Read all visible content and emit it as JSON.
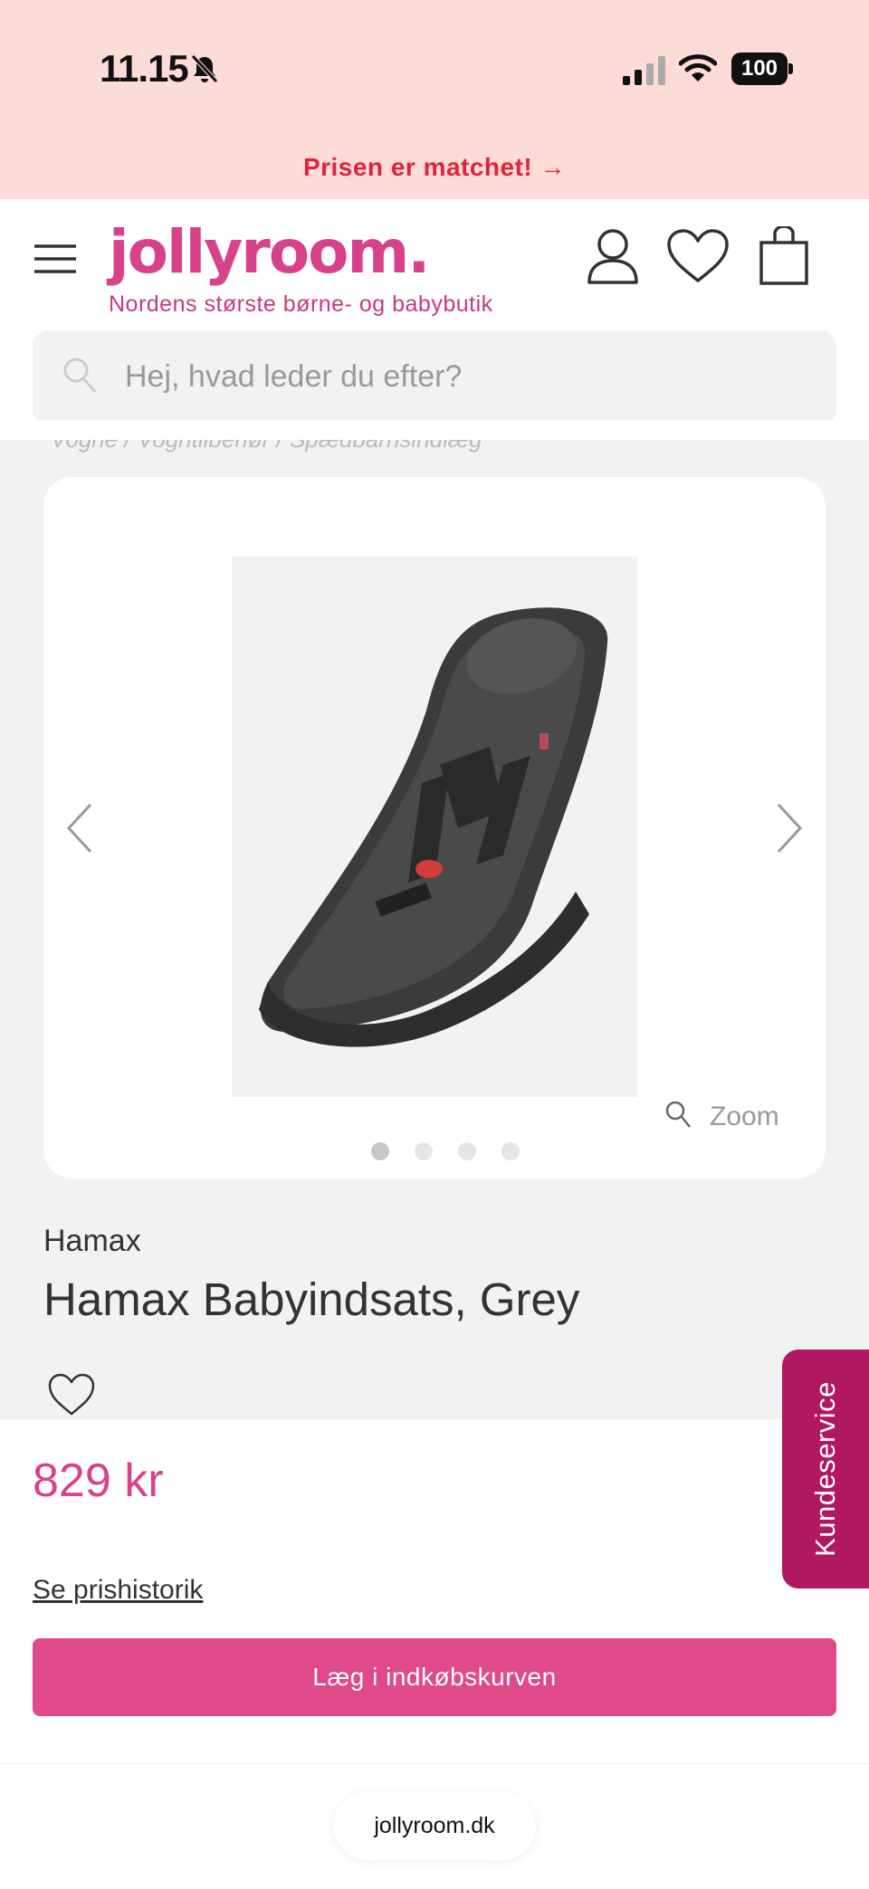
{
  "status_bar": {
    "time": "11.15",
    "battery": "100",
    "icons": [
      "bell-muted-icon",
      "signal-icon",
      "wifi-icon",
      "battery-icon"
    ]
  },
  "promo": {
    "text": "Prisen er matchet! →"
  },
  "header": {
    "logo": "jollyroom.",
    "tagline": "Nordens største børne- og babybutik",
    "icons": [
      "menu-icon",
      "user-icon",
      "heart-icon",
      "bag-icon"
    ]
  },
  "search": {
    "placeholder": "Hej, hvad leder du efter?"
  },
  "breadcrumb": {
    "text": "Vogne / Vogntilbehør / Spædbarnsindlæg"
  },
  "gallery": {
    "zoom_label": "Zoom",
    "image_count": 4,
    "active_index": 0
  },
  "product": {
    "brand": "Hamax",
    "title": "Hamax Babyindsats, Grey",
    "price": "829 kr",
    "price_history": "Se prishistorik",
    "add_to_cart": "Læg i indkøbskurven"
  },
  "customer_service": {
    "label": "Kundeservice"
  },
  "browser": {
    "url": "jollyroom.dk"
  },
  "colors": {
    "brand": "#d8428a",
    "button": "#e0498a",
    "promo_bg": "#fddcd8",
    "promo_text": "#e0243a",
    "service_tab": "#b0185f"
  }
}
